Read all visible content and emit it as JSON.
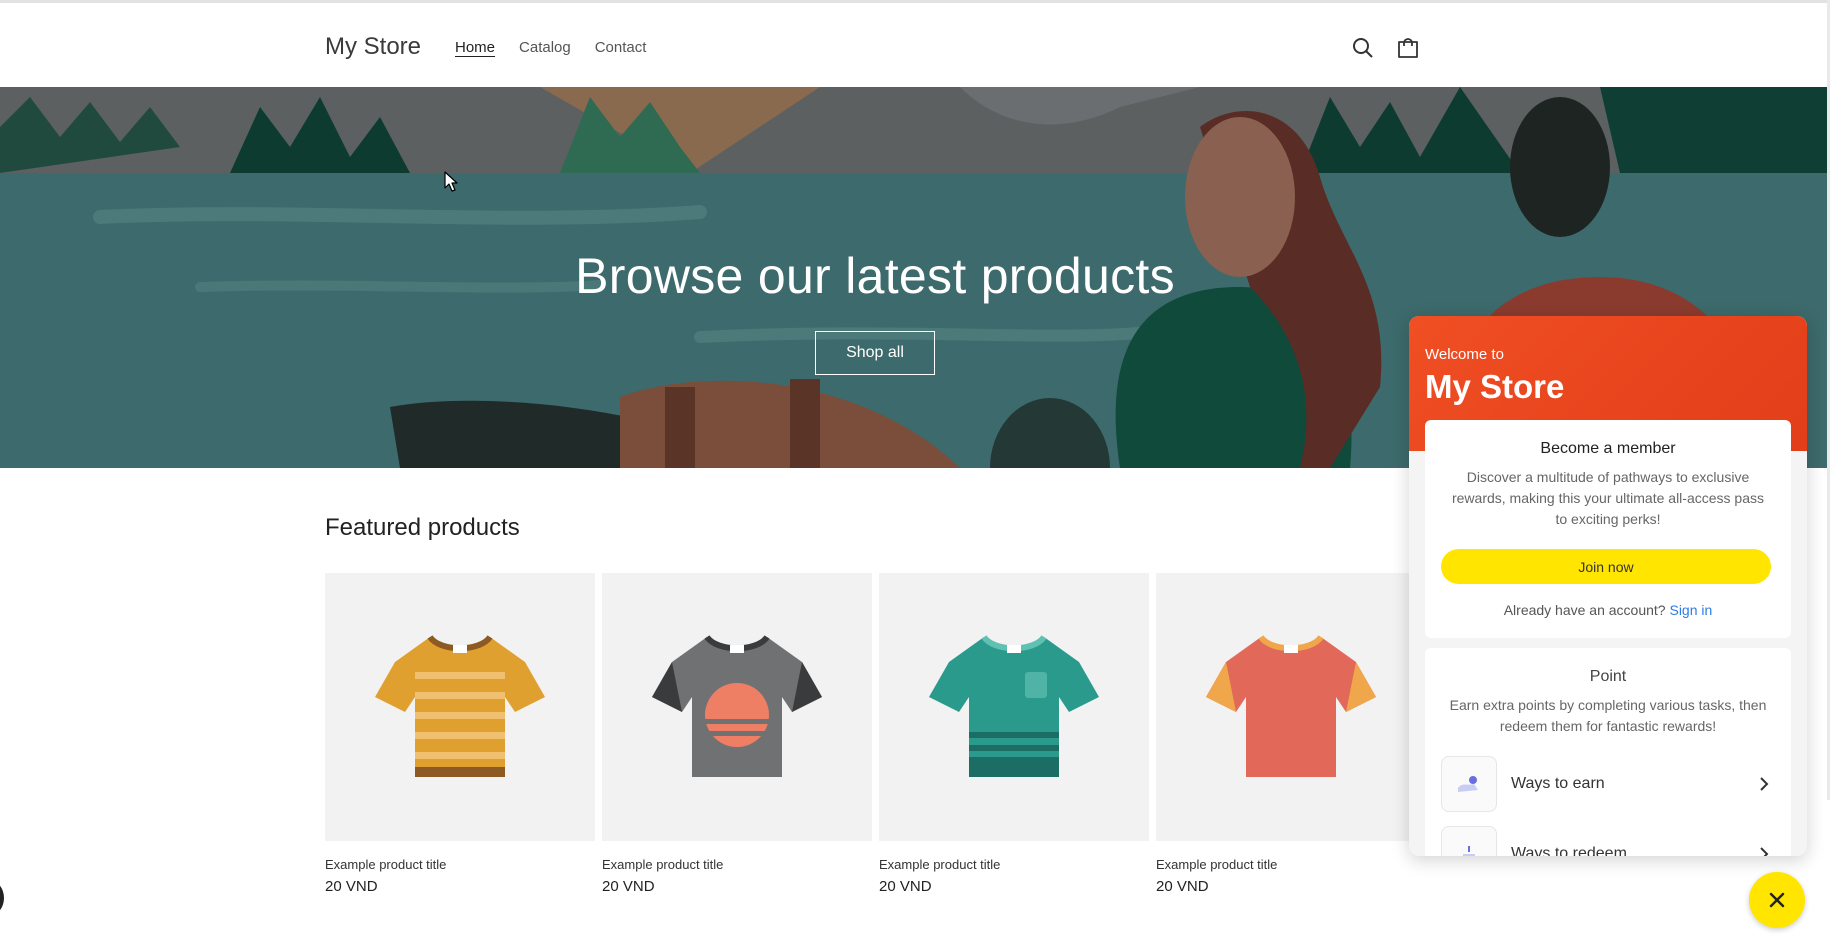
{
  "header": {
    "logo": "My Store",
    "nav": [
      "Home",
      "Catalog",
      "Contact"
    ],
    "icons": [
      "search-icon",
      "cart-icon"
    ]
  },
  "hero": {
    "title": "Browse our latest products",
    "button": "Shop all"
  },
  "featured": {
    "title": "Featured products",
    "products": [
      {
        "title": "Example product title",
        "price": "20 VND",
        "color": "#e0a030"
      },
      {
        "title": "Example product title",
        "price": "20 VND",
        "color": "#707173"
      },
      {
        "title": "Example product title",
        "price": "20 VND",
        "color": "#2a9a8c"
      },
      {
        "title": "Example product title",
        "price": "20 VND",
        "color": "#e2695a"
      }
    ]
  },
  "widget": {
    "welcome": "Welcome to",
    "store": "My Store",
    "member_title": "Become a member",
    "member_desc": "Discover a multitude of pathways to exclusive rewards, making this your ultimate all-access pass to exciting perks!",
    "join": "Join now",
    "already": "Already have an account?",
    "signin": "Sign in",
    "point_title": "Point",
    "point_desc": "Earn extra points by completing various tasks, then redeem them for fantastic rewards!",
    "ways": [
      "Ways to earn",
      "Ways to redeem"
    ]
  },
  "colors": {
    "accent": "#f04e23",
    "button_yellow": "#ffe500",
    "link": "#2d7be5"
  }
}
